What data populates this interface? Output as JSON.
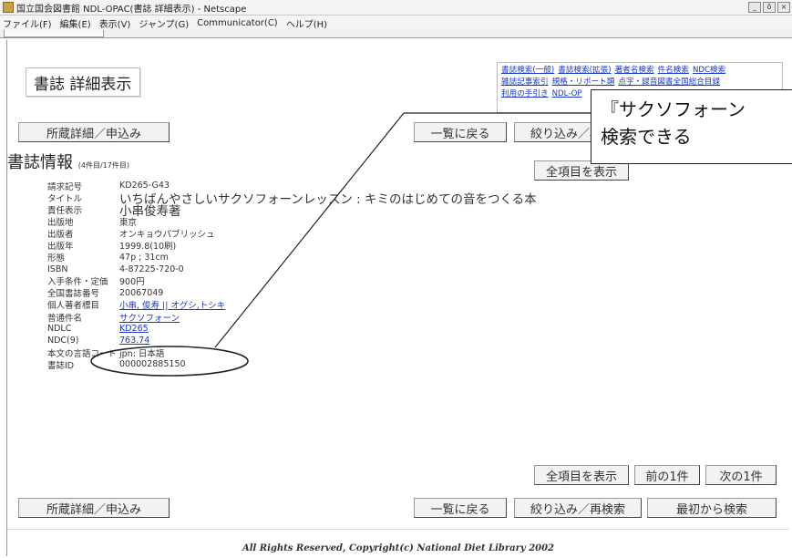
{
  "window": {
    "title": "国立国会図書館 NDL-OPAC(書誌 詳細表示) - Netscape",
    "buttons": [
      "_",
      "ō",
      "×"
    ]
  },
  "menu": [
    "ファイル(F)",
    "編集(E)",
    "表示(V)",
    "ジャンプ(G)",
    "Communicator(C)",
    "ヘルプ(H)"
  ],
  "header": {
    "title": "書誌 詳細表示"
  },
  "search_links": {
    "row1": [
      "書誌検索(一般)",
      "書誌検索(拡張)",
      "著者名検索",
      "件名検索",
      "NDC検索"
    ],
    "row2": [
      "雑誌記事索引",
      "規格・リポート類",
      "点字・録音図書全国総合目録"
    ],
    "row3": [
      "利用の手引き",
      "NDL-OP"
    ]
  },
  "buttons": {
    "holdings": "所蔵詳細／申込み",
    "back_to_list": "一覧に戻る",
    "refine": "絞り込み／再検索",
    "show_all_items": "全項目を表示",
    "prev": "前の1件",
    "next": "次の1件",
    "search_from_start": "最初から検索"
  },
  "section": {
    "title": "書誌情報",
    "subtitle": "(4件目/17件目)"
  },
  "record": [
    {
      "label": "請求記号",
      "value": "KD265-G43"
    },
    {
      "label": "タイトル",
      "value": "いちばんやさしいサクソフォーンレッスン : キミのはじめての音をつくる本"
    },
    {
      "label": "責任表示",
      "value": "小串俊寿著"
    },
    {
      "label": "出版地",
      "value": "東京"
    },
    {
      "label": "出版者",
      "value": "オンキョウパブリッシュ"
    },
    {
      "label": "出版年",
      "value": "1999.8(10刷)"
    },
    {
      "label": "形態",
      "value": "47p ; 31cm"
    },
    {
      "label": "ISBN",
      "value": "4-87225-720-0"
    },
    {
      "label": "入手条件・定価",
      "value": "900円"
    },
    {
      "label": "全国書誌番号",
      "value": "20067049"
    },
    {
      "label": "個人著者標目",
      "value": "小串, 俊寿 || オグシ,トシキ"
    },
    {
      "label": "普通件名",
      "value": "サクソフォーン"
    },
    {
      "label": "NDLC",
      "value": "KD265"
    },
    {
      "label": "NDC(9)",
      "value": "763.74"
    },
    {
      "label": "本文の言語コード",
      "value": "jpn: 日本語"
    },
    {
      "label": "書誌ID",
      "value": "000002885150"
    }
  ],
  "callout": {
    "line1": "『サクソフォーン",
    "line2": "検索できる"
  },
  "footer": "All Rights Reserved, Copyright(c) National Diet Library 2002",
  "colors": {
    "link": "#1a38c8",
    "chrome": "#f4f4f4",
    "button": "#f2f2f2"
  }
}
